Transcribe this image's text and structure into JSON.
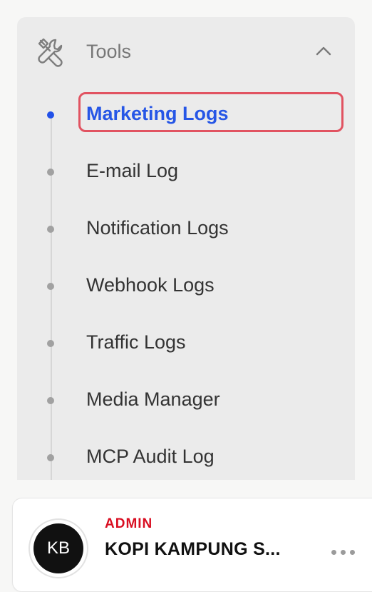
{
  "sidebar": {
    "section": {
      "title": "Tools",
      "icon": "tools-icon",
      "expanded": true
    },
    "items": [
      {
        "label": "Marketing Logs",
        "active": true
      },
      {
        "label": "E-mail Log",
        "active": false
      },
      {
        "label": "Notification Logs",
        "active": false
      },
      {
        "label": "Webhook Logs",
        "active": false
      },
      {
        "label": "Traffic Logs",
        "active": false
      },
      {
        "label": "Media Manager",
        "active": false
      },
      {
        "label": "MCP Audit Log",
        "active": false
      }
    ]
  },
  "account": {
    "initials": "KB",
    "role": "ADMIN",
    "name": "KOPI KAMPUNG S..."
  },
  "colors": {
    "active": "#2656e6",
    "highlight": "#e15361",
    "role": "#d90e21"
  }
}
